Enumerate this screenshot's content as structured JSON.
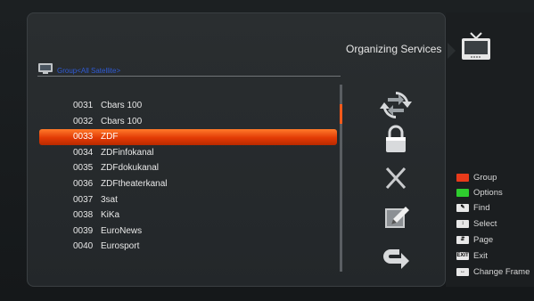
{
  "header": {
    "title": "Organizing Services"
  },
  "group": {
    "label": "Group<All Satellite>"
  },
  "channels": [
    {
      "num": "0031",
      "name": "Cbars 100",
      "selected": false
    },
    {
      "num": "0032",
      "name": "Cbars 100",
      "selected": false
    },
    {
      "num": "0033",
      "name": "ZDF",
      "selected": true
    },
    {
      "num": "0034",
      "name": "ZDFinfokanal",
      "selected": false
    },
    {
      "num": "0035",
      "name": "ZDFdokukanal",
      "selected": false
    },
    {
      "num": "0036",
      "name": "ZDFtheaterkanal",
      "selected": false
    },
    {
      "num": "0037",
      "name": "3sat",
      "selected": false
    },
    {
      "num": "0038",
      "name": "KiKa",
      "selected": false
    },
    {
      "num": "0039",
      "name": "EuroNews",
      "selected": false
    },
    {
      "num": "0040",
      "name": "Eurosport",
      "selected": false
    }
  ],
  "actions": [
    {
      "name": "move-icon"
    },
    {
      "name": "lock-icon"
    },
    {
      "name": "delete-icon"
    },
    {
      "name": "rename-icon"
    },
    {
      "name": "back-icon"
    }
  ],
  "legend": [
    {
      "key": "red",
      "key_text": "",
      "label": "Group"
    },
    {
      "key": "green",
      "key_text": "",
      "label": "Options"
    },
    {
      "key": "white",
      "key_text": "",
      "label": "Find"
    },
    {
      "key": "white",
      "key_text": "",
      "label": "Select"
    },
    {
      "key": "white",
      "key_text": "",
      "label": "Page"
    },
    {
      "key": "white",
      "key_text": "EXIT",
      "label": "Exit"
    },
    {
      "key": "white",
      "key_text": "",
      "label": "Change Frame"
    }
  ],
  "colors": {
    "highlight": "#e23a05",
    "accent_blue": "#2f5bd6",
    "panel": "#2a2e30"
  }
}
